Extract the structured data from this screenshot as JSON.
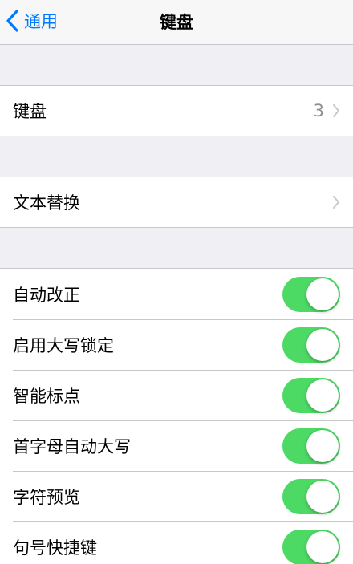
{
  "nav": {
    "back_label": "通用",
    "title": "键盘"
  },
  "keyboards": {
    "label": "键盘",
    "count": "3"
  },
  "text_replacement": {
    "label": "文本替换"
  },
  "toggles": [
    {
      "label": "自动改正",
      "on": true
    },
    {
      "label": "启用大写锁定",
      "on": true
    },
    {
      "label": "智能标点",
      "on": true
    },
    {
      "label": "首字母自动大写",
      "on": true
    },
    {
      "label": "字符预览",
      "on": true
    },
    {
      "label": "句号快捷键",
      "on": true
    }
  ],
  "colors": {
    "accent": "#007aff",
    "toggle_on": "#4cd964",
    "background": "#efeff4"
  }
}
